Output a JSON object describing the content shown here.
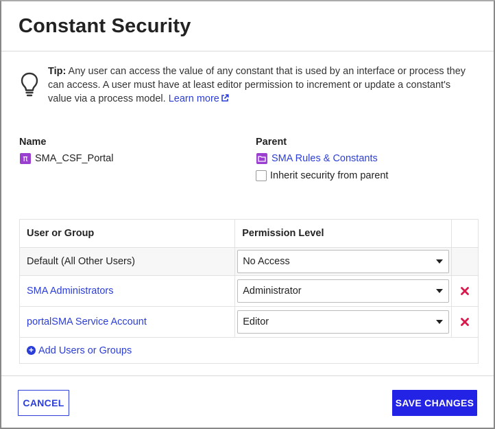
{
  "dialog": {
    "title": "Constant Security"
  },
  "tip": {
    "bold": "Tip:",
    "text": " Any user can access the value of any constant that is used by an interface or process they can access. A user must have at least editor permission to increment or update a constant's value via a process model. ",
    "link": "Learn more"
  },
  "name_section": {
    "label": "Name",
    "value": "SMA_CSF_Portal",
    "icon_glyph": "π"
  },
  "parent_section": {
    "label": "Parent",
    "value": "SMA Rules & Constants",
    "inherit_label": "Inherit security from parent",
    "inherit_checked": false
  },
  "table": {
    "headers": [
      "User or Group",
      "Permission Level",
      ""
    ],
    "rows": [
      {
        "name": "Default (All Other Users)",
        "permission": "No Access",
        "removable": false
      },
      {
        "name": "SMA Administrators",
        "permission": "Administrator",
        "removable": true
      },
      {
        "name": "portalSMA Service Account",
        "permission": "Editor",
        "removable": true
      }
    ],
    "add_label": "Add Users or Groups"
  },
  "footer": {
    "cancel_label": "CANCEL",
    "save_label": "SAVE CHANGES"
  },
  "colors": {
    "accent": "#2b3dd9",
    "primary_button": "#2323e6",
    "remove": "#d9194b",
    "object_icon": "#9a3fd0"
  }
}
